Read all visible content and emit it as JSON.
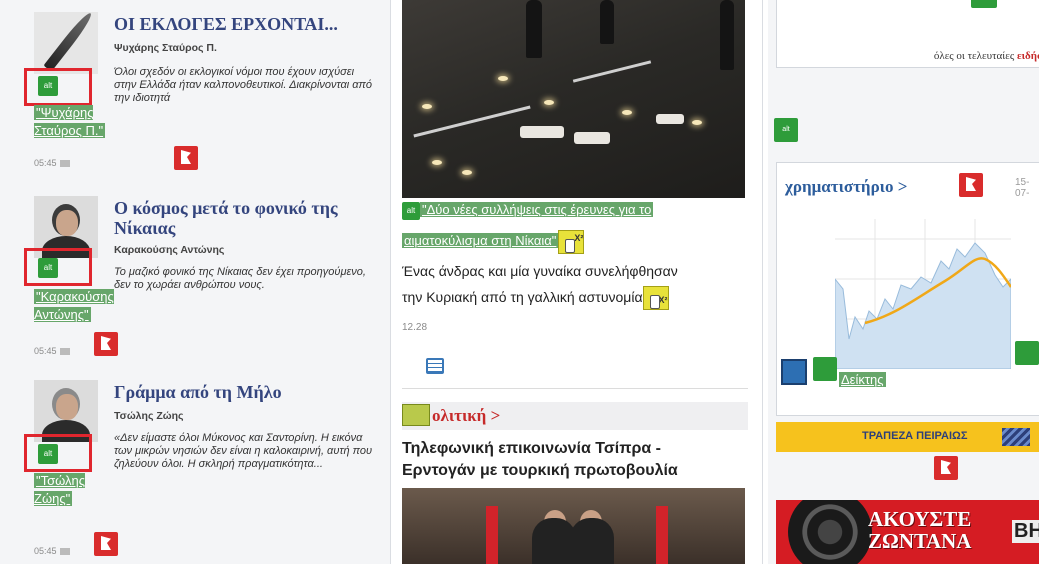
{
  "articles": [
    {
      "title": "ΟΙ ΕΚΛΟΓΕΣ ΕΡΧΟΝΤΑΙ...",
      "author": "Ψυχάρης Σταύρος Π.",
      "excerpt": "Όλοι σχεδόν οι εκλογικοί νόμοι που έχουν ισχύσει στην Ελλάδα ήταν καλπονοθευτικοί. Διακρίνονται από την ιδιοτητά",
      "alt_text": "\"Ψυχάρης Σταύρος Π.\"",
      "time": "05:45",
      "badge": "alt"
    },
    {
      "title": "Ο κόσμος μετά το φονικό της Νίκαιας",
      "author": "Καρακούσης Αντώνης",
      "excerpt": "Το μαζικό φονικό της Νίκαιας δεν έχει προηγούμενο, δεν το χωράει ανθρώπου νους.",
      "alt_text": "\"Καρακούσης Αντώνης\"",
      "time": "05:45",
      "badge": "alt"
    },
    {
      "title": "Γράμμα από τη Μήλο",
      "author": "Τσώλης Ζώης",
      "excerpt": "«Δεν είμαστε όλοι Μύκονος και Σαντορίνη. Η εικόνα των μικρών νησιών δεν είναι η καλοκαιρινή, αυτή που ζηλεύουν όλοι. Η σκληρή πραγματικότητα...",
      "alt_text": "\"Τσώλης Ζώης\"",
      "time": "05:45",
      "badge": "alt"
    }
  ],
  "main": {
    "photo_alt": "\"Δύο νέες συλλήψεις στις έρευνες για το αιματοκύλισμα στη Νίκαια\"",
    "caption_line1": "\"Δύο νέες συλλήψεις στις έρευνες για το",
    "caption_line2": "αιματοκύλισμα στη Νίκαια\"",
    "lead_line1": "Ένας άνδρας και μία γυναίκα συνελήφθησαν",
    "lead_line2": "την Κυριακή από τη γαλλική αστυνομία",
    "time": "12.28",
    "section_title": "ολιτική",
    "section_arrow": ">",
    "headline_line1": "Τηλεφωνική επικοινωνία Τσίπρα -",
    "headline_line2": "Ερντογάν με τουρκική πρωτοβουλία",
    "x_badge": "X²"
  },
  "right": {
    "results_link_prefix": "όλες οι τελευταίες",
    "results_link_highlight": "ειδήσ",
    "stock_title": "χρηματιστήριο",
    "stock_arrow": ">",
    "stock_date": "15-07-",
    "stock_link": "Δείκτης",
    "bank_name": "ΤΡΑΠΕΖΑ ΠΕΙΡΑΙΩΣ",
    "radio_line1": "ΑΚΟΥΣΤΕ",
    "radio_line2": "ΖΩΝΤΑΝΑ",
    "radio_side": "ΒΗ",
    "badge": "alt"
  },
  "colors": {
    "title_blue": "#34457e",
    "alt_highlight": "#67a66a",
    "flag_red": "#d92c2c",
    "section_red": "#c62a2a",
    "stock_blue": "#2d5d9c",
    "bank_yellow": "#f6c21d"
  },
  "icons": [
    "quill-icon",
    "report-flag-icon",
    "comment-icon",
    "list-icon",
    "x-badge-icon",
    "alt-badge-icon",
    "chart-icon",
    "speaker-icon"
  ]
}
